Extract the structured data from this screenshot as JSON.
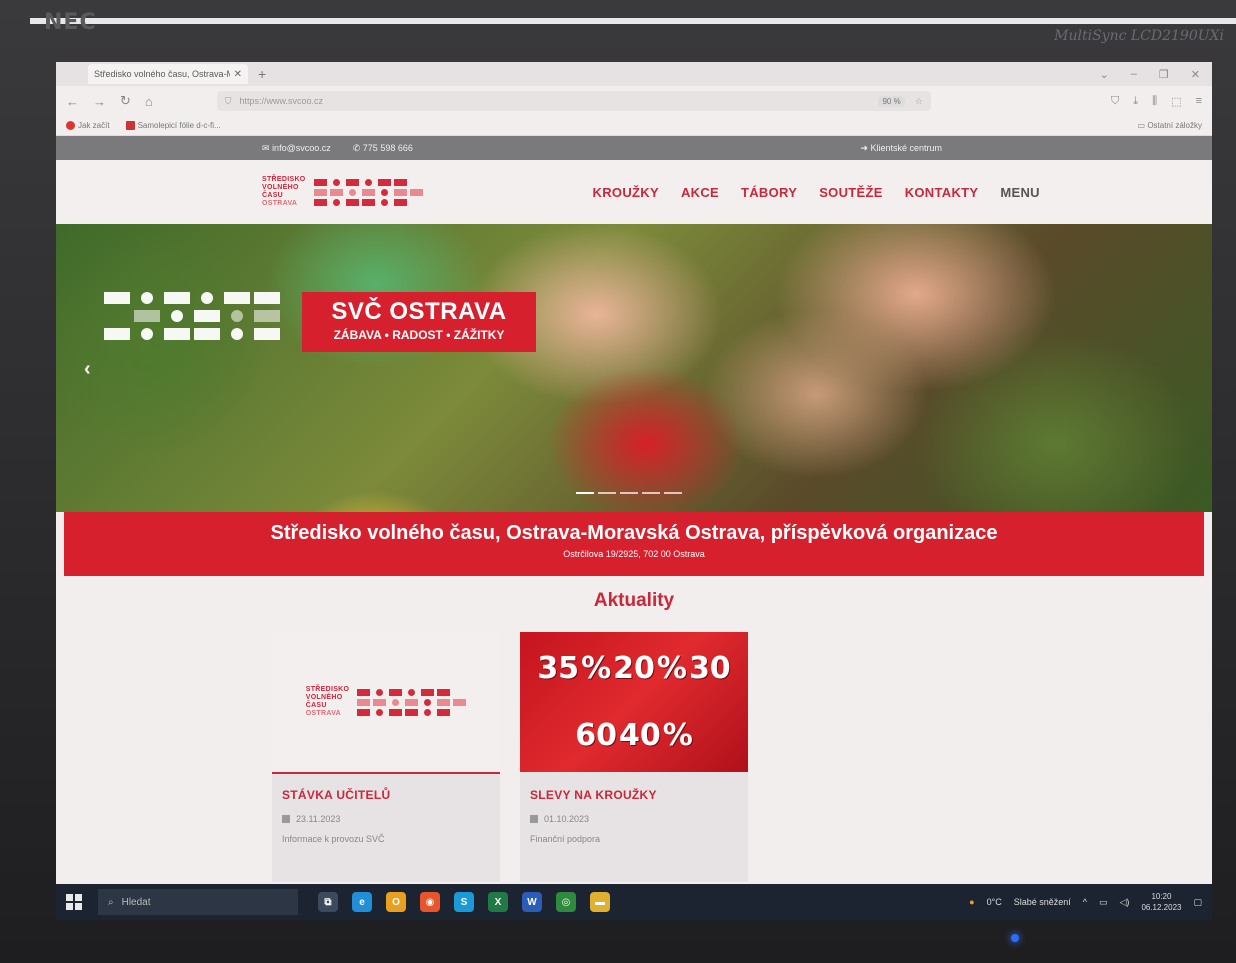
{
  "monitor": {
    "brand": "NEC",
    "model": "MultiSync LCD2190UXi"
  },
  "browser": {
    "tab_title": "Středisko volného času, Ostrava-Mo",
    "url": "https://www.svcoo.cz",
    "zoom": "90 %",
    "bookmarks": [
      "Jak začít",
      "Samolepicí fólie d-c-fi..."
    ],
    "other_bookmarks": "Ostatní záložky"
  },
  "site": {
    "topbar": {
      "email": "info@svcoo.cz",
      "phone": "775 598 666",
      "client": "Klientské centrum"
    },
    "logo": {
      "line1": "STŘEDISKO",
      "line2": "VOLNÉHO",
      "line3": "ČASU",
      "line4": "OSTRAVA"
    },
    "nav": [
      "KROUŽKY",
      "AKCE",
      "TÁBORY",
      "SOUTĚŽE",
      "KONTAKTY",
      "MENU"
    ],
    "hero": {
      "title": "SVČ OSTRAVA",
      "subtitle": "ZÁBAVA • RADOST • ZÁŽITKY"
    },
    "band": {
      "title": "Středisko volného času, Ostrava-Moravská Ostrava, příspěvková organizace",
      "address": "Ostrčilova 19/2925, 702 00 Ostrava"
    },
    "news": {
      "heading": "Aktuality",
      "items": [
        {
          "title": "STÁVKA UČITELŮ",
          "date": "23.11.2023",
          "desc": "Informace k provozu SVČ"
        },
        {
          "title": "SLEVY NA KROUŽKY",
          "date": "01.10.2023",
          "desc": "Finanční podpora"
        }
      ],
      "sale_numbers": [
        "35",
        "%",
        "20",
        "%",
        "30",
        "60",
        "40",
        "%"
      ]
    }
  },
  "taskbar": {
    "search_placeholder": "Hledat",
    "weather": "0°C",
    "weather_desc": "Slabé sněžení",
    "time": "10:20",
    "date": "06.12.2023"
  }
}
